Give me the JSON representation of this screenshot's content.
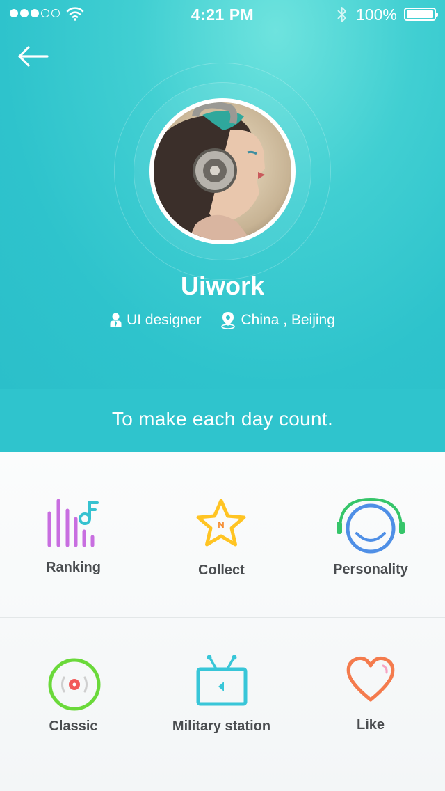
{
  "status_bar": {
    "time": "4:21 PM",
    "battery": "100%",
    "icons": [
      "signal-dots",
      "wifi-icon",
      "bluetooth-icon",
      "battery-icon"
    ]
  },
  "profile": {
    "name": "Uiwork",
    "role": "UI designer",
    "location": "China , Beijing",
    "motto": "To make each day count."
  },
  "menu": [
    {
      "label": "Ranking",
      "icon": "ranking-icon"
    },
    {
      "label": "Collect",
      "icon": "star-icon"
    },
    {
      "label": "Personality",
      "icon": "headphones-smile-icon"
    },
    {
      "label": "Classic",
      "icon": "vinyl-record-icon"
    },
    {
      "label": "Military station",
      "icon": "tv-icon"
    },
    {
      "label": "Like",
      "icon": "heart-icon"
    }
  ],
  "colors": {
    "header": "#2ec3cc",
    "ranking": "#c86ee0",
    "ranking_note": "#36c2d0",
    "collect": "#ffc423",
    "personality": "#4f8fe6",
    "personality_band": "#36c56a",
    "classic": "#6ad93a",
    "tv": "#38c6d8",
    "like": "#f47b4d"
  }
}
